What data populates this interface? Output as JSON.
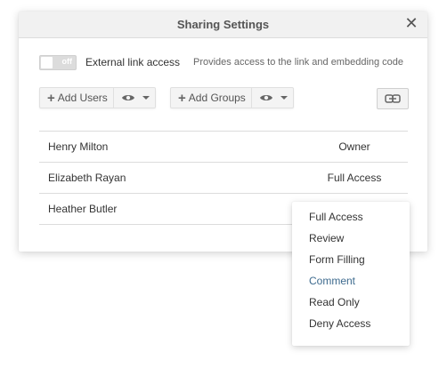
{
  "dialog": {
    "title": "Sharing Settings",
    "close_symbol": "✕"
  },
  "external_link": {
    "toggle_text": "off",
    "label": "External link access",
    "description": "Provides access to the link and embedding code"
  },
  "toolbar": {
    "add_users": "Add Users",
    "add_groups": "Add Groups",
    "plus_symbol": "+"
  },
  "users": [
    {
      "name": "Henry Milton",
      "access": "Owner"
    },
    {
      "name": "Elizabeth Rayan",
      "access": "Full Access"
    },
    {
      "name": "Heather Butler",
      "access": ""
    }
  ],
  "access_menu": {
    "items": [
      "Full Access",
      "Review",
      "Form Filling",
      "Comment",
      "Read Only",
      "Deny Access"
    ],
    "selected": "Comment",
    "selected_color": "#3d6a8e"
  },
  "icons": {
    "close": "close-icon",
    "eye": "eye-icon",
    "link": "link-icon",
    "plus": "plus-icon",
    "caret": "chevron-down-icon"
  }
}
